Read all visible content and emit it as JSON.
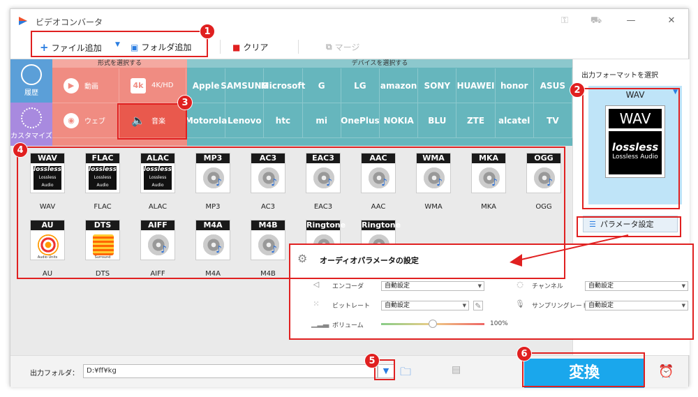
{
  "window": {
    "title": "ビデオコンバータ"
  },
  "toolbar": {
    "add_file": "ファイル追加",
    "add_folder": "フォルダ追加",
    "clear": "クリア",
    "merge": "マージ"
  },
  "side": {
    "history": "履歴",
    "custom": "カスタマイズ"
  },
  "format_header": "形式を選択する",
  "device_header": "デバイスを選択する",
  "format_types": [
    "動画",
    "4K/HD",
    "ウェブ",
    "音楽"
  ],
  "devices_row1": [
    "Apple",
    "SAMSUNG",
    "Microsoft",
    "G",
    "LG",
    "amazon",
    "SONY",
    "HUAWEI",
    "honor",
    "ASUS"
  ],
  "devices_row2": [
    "Motorola",
    "Lenovo",
    "htc",
    "mi",
    "OnePlus",
    "NOKIA",
    "BLU",
    "ZTE",
    "alcatel",
    "TV"
  ],
  "formats": [
    "WAV",
    "FLAC",
    "ALAC",
    "MP3",
    "AC3",
    "EAC3",
    "AAC",
    "WMA",
    "MKA",
    "OGG",
    "AU",
    "DTS",
    "AIFF",
    "M4A",
    "M4B",
    "Ringtone",
    "Ringtone"
  ],
  "lossless_text": "lossless",
  "lossless_sub": "Lossless Audio",
  "au_sub": "Audio Units",
  "dts_sub": "Surround",
  "right": {
    "title": "出力フォーマットを選択",
    "selected": "WAV",
    "param_btn": "パラメータ設定"
  },
  "popup": {
    "title": "オーディオパラメータの設定",
    "encoder_label": "エンコーダ",
    "encoder_value": "自動設定",
    "bitrate_label": "ビットレート",
    "bitrate_value": "自動設定",
    "volume_label": "ボリューム",
    "volume_value": "100%",
    "volume_level": 0.5,
    "channel_label": "チャンネル",
    "channel_value": "自動設定",
    "sample_label": "サンプリングレート",
    "sample_value": "自動設定"
  },
  "bottom": {
    "out_label": "出力フォルダ：",
    "out_value": "D:¥ff¥kg",
    "convert": "変換"
  },
  "badges": [
    "1",
    "2",
    "3",
    "4",
    "5",
    "6"
  ],
  "colors": {
    "accent": "#1aa7ec",
    "format_bg": "#f08c82",
    "device_bg": "#66b6bd",
    "annotation": "#e02020"
  }
}
